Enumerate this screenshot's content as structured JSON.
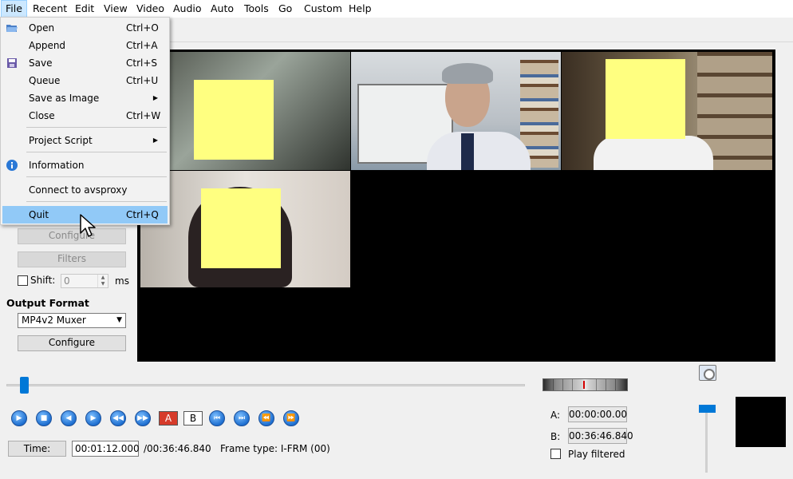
{
  "menubar": {
    "items": [
      "File",
      "Recent",
      "Edit",
      "View",
      "Video",
      "Audio",
      "Auto",
      "Tools",
      "Go",
      "Custom",
      "Help"
    ]
  },
  "file_menu": {
    "items": [
      {
        "label": "Open",
        "shortcut": "Ctrl+O",
        "icon": "folder-open-icon"
      },
      {
        "label": "Append",
        "shortcut": "Ctrl+A"
      },
      {
        "label": "Save",
        "shortcut": "Ctrl+S",
        "icon": "save-icon"
      },
      {
        "label": "Queue",
        "shortcut": "Ctrl+U"
      },
      {
        "label": "Save as Image",
        "submenu": true
      },
      {
        "label": "Close",
        "shortcut": "Ctrl+W"
      },
      {
        "label": "Project Script",
        "submenu": true
      },
      {
        "label": "Information",
        "icon": "info-icon"
      },
      {
        "label": "Connect to avsproxy"
      },
      {
        "label": "Quit",
        "shortcut": "Ctrl+Q",
        "highlighted": true
      }
    ]
  },
  "audio_output": {
    "configure_label": "Configure",
    "filters_label": "Filters",
    "shift_label": "Shift:",
    "shift_value": "0",
    "shift_unit": "ms"
  },
  "output_format": {
    "title": "Output Format",
    "selected": "MP4v2 Muxer",
    "configure_label": "Configure"
  },
  "timeline": {
    "position_fraction": 0.034
  },
  "transport": {
    "marker_a_label": "A",
    "marker_b_label": "B"
  },
  "status": {
    "time_button": "Time:",
    "current_time": "00:01:12.000",
    "total_time": "/00:36:46.840",
    "frame_type": "Frame type:  I-FRM (00)"
  },
  "selection": {
    "a_label": "A:",
    "a_value": "00:00:00.00",
    "b_label": "B:",
    "b_value": "00:36:46.840",
    "play_filtered_label": "Play filtered"
  },
  "colors": {
    "accent": "#0078d7",
    "menu_highlight": "#91c9f7",
    "sticky_note": "#ffff80"
  }
}
